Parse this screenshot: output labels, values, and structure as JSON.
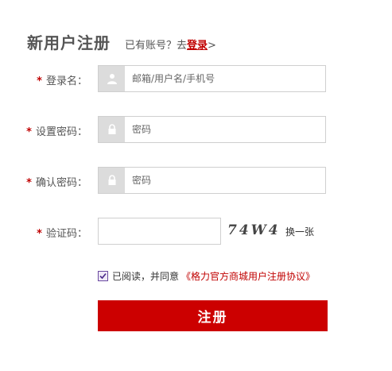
{
  "header": {
    "title": "新用户注册",
    "have_account": "已有账号？去",
    "login_link": "登录",
    "gt": ">"
  },
  "form": {
    "required_mark": "*",
    "username": {
      "label": "登录名：",
      "placeholder": "邮箱/用户名/手机号",
      "icon": "user-icon"
    },
    "password": {
      "label": "设置密码：",
      "placeholder": "密码",
      "icon": "lock-icon"
    },
    "confirm": {
      "label": "确认密码：",
      "placeholder": "密码",
      "icon": "lock-icon"
    },
    "captcha": {
      "label": "验证码：",
      "image_text": "74W4",
      "refresh": "换一张"
    }
  },
  "agreement": {
    "checked": true,
    "text": "已阅读，并同意",
    "link": "《格力官方商城用户注册协议》"
  },
  "submit": {
    "label": "注册"
  },
  "colors": {
    "accent": "#cc0000",
    "icon_bg": "#dcdcdc",
    "border": "#cfcfcf"
  }
}
